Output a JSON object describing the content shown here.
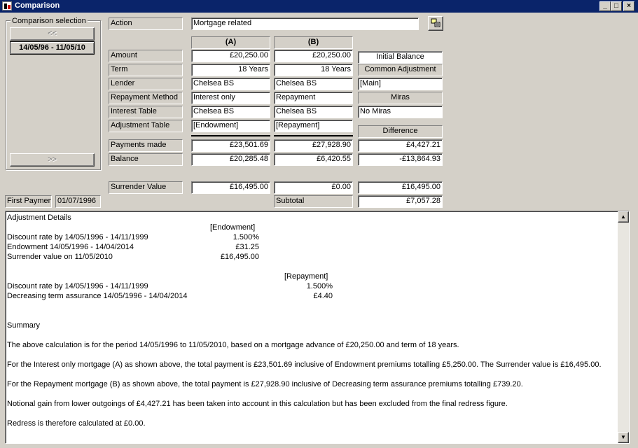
{
  "window": {
    "title": "Comparison"
  },
  "comparison_selection": {
    "legend": "Comparison selection",
    "prev_label": "<<",
    "selected_period": "14/05/96 - 11/05/10",
    "next_label": ">>"
  },
  "action": {
    "label": "Action",
    "value": "Mortgage related"
  },
  "columns": {
    "a": "(A)",
    "b": "(B)"
  },
  "rows": {
    "amount": {
      "label": "Amount",
      "a": "£20,250.00",
      "b": "£20,250.00"
    },
    "term": {
      "label": "Term",
      "a": "18 Years",
      "b": "18 Years"
    },
    "lender": {
      "label": "Lender",
      "a": "Chelsea BS",
      "b": "Chelsea BS"
    },
    "repayment_method": {
      "label": "Repayment Method",
      "a": "Interest only",
      "b": "Repayment"
    },
    "interest_table": {
      "label": "Interest Table",
      "a": "Chelsea BS",
      "b": "Chelsea BS"
    },
    "adjustment_table": {
      "label": "Adjustment Table",
      "a": "[Endowment]",
      "b": "[Repayment]"
    },
    "payments_made": {
      "label": "Payments made",
      "a": "£23,501.69",
      "b": "£27,928.90",
      "diff": "£4,427.21"
    },
    "balance": {
      "label": "Balance",
      "a": "£20,285.48",
      "b": "£6,420.55",
      "diff": "-£13,864.93"
    },
    "surrender_value": {
      "label": "Surrender Value",
      "a": "£16,495.00",
      "b": "£0.00",
      "diff": "£16,495.00"
    }
  },
  "right_panel": {
    "initial_balance": "Initial Balance",
    "common_adjustment": "Common Adjustment",
    "main_value": "[Main]",
    "miras_label": "Miras",
    "miras_value": "No Miras",
    "difference_label": "Difference",
    "subtotal_label": "Subtotal",
    "subtotal_value": "£7,057.28"
  },
  "first_payment": {
    "label": "First Payment",
    "value": "01/07/1996"
  },
  "details": {
    "heading": "Adjustment Details",
    "endowment": {
      "header": "[Endowment]",
      "lines": [
        {
          "text": "Discount rate by 14/05/1996 - 14/11/1999",
          "value": "1.500%"
        },
        {
          "text": "Endowment 14/05/1996 - 14/04/2014",
          "value": "£31.25"
        },
        {
          "text": "Surrender value on 11/05/2010",
          "value": "£16,495.00"
        }
      ]
    },
    "repayment": {
      "header": "[Repayment]",
      "lines": [
        {
          "text": "Discount rate by 14/05/1996 - 14/11/1999",
          "value": "1.500%"
        },
        {
          "text": "Decreasing term assurance 14/05/1996 - 14/04/2014",
          "value": "£4.40"
        }
      ]
    },
    "summary_heading": "Summary",
    "summary": [
      "The above calculation is for the period 14/05/1996 to 11/05/2010, based on a mortgage advance of £20,250.00 and term of 18 years.",
      "For the Interest only mortgage (A) as shown above, the total payment is £23,501.69 inclusive of Endowment premiums totalling £5,250.00. The Surrender value is £16,495.00.",
      "For the Repayment mortgage (B) as shown above, the total payment is £27,928.90 inclusive of Decreasing term assurance premiums totalling £739.20.",
      "Notional gain from lower outgoings of £4,427.21 has been taken into account in this calculation but has been excluded from the final redress figure.",
      "Redress is therefore calculated at £0.00."
    ]
  }
}
